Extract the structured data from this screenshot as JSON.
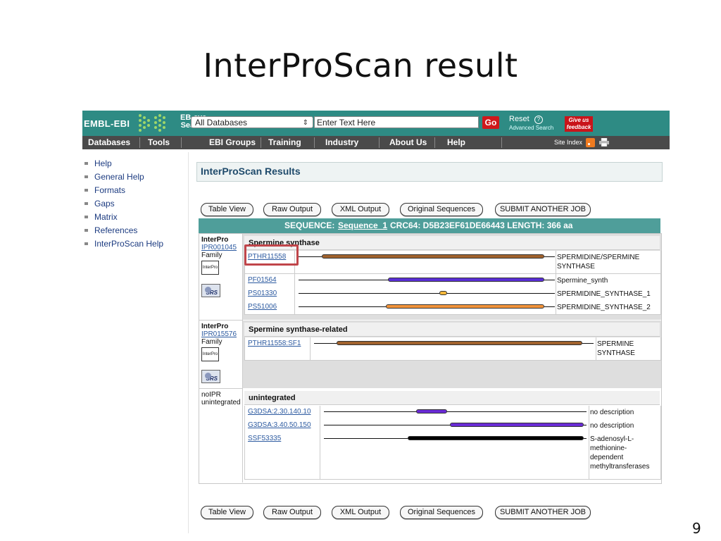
{
  "slide": {
    "title": "InterProScan result",
    "page_number": "9"
  },
  "header": {
    "logo": "EMBL-EBI",
    "eb_eye_line1": "EB-eye",
    "eb_eye_line2": "Search",
    "database_select": "All Databases",
    "search_placeholder": "Enter Text Here",
    "go_label": "Go",
    "reset_label": "Reset",
    "help_glyph": "?",
    "advanced_search": "Advanced Search",
    "feedback_line1": "Give us",
    "feedback_line2": "feedback",
    "brand_color": "#2e8b84",
    "go_color": "#d0181b"
  },
  "nav": {
    "items": [
      "Databases",
      "Tools",
      "EBI Groups",
      "Training",
      "Industry",
      "About Us",
      "Help"
    ],
    "site_index": "Site Index",
    "rss_icon": "rss-icon",
    "print_icon": "print-icon"
  },
  "sidebar": {
    "links": [
      "Help",
      "General Help",
      "Formats",
      "Gaps",
      "Matrix",
      "References",
      "InterProScan Help"
    ]
  },
  "results": {
    "title": "InterProScan Results",
    "buttons": [
      "Table View",
      "Raw Output",
      "XML Output",
      "Original Sequences",
      "SUBMIT ANOTHER JOB"
    ],
    "sequence_bar": {
      "prefix": "SEQUENCE:",
      "sequence_link": "Sequence_1",
      "suffix": "CRC64: D5B23EF61DE66443 LENGTH: 366 aa"
    },
    "sequence_length": 366,
    "entries": [
      {
        "type_label": "InterPro",
        "accession": "IPR001045",
        "kind": "Family",
        "badge": "InterPro",
        "srs": "SRS",
        "title": "Spermine synthase",
        "matches": [
          {
            "acc": "PTHR11558",
            "label_line1": "SPERMIDINE/SPERMINE",
            "label_line2": "SYNTHASE",
            "start": 0.09,
            "end": 0.96,
            "color": "#a0622d"
          },
          {
            "acc": "PF01564",
            "label_line1": "Spermine_synth",
            "label_line2": "",
            "start": 0.35,
            "end": 0.96,
            "color": "#5a2fd6"
          },
          {
            "acc": "PS01330",
            "label_line1": "SPERMIDINE_SYNTHASE_1",
            "label_line2": "",
            "start": 0.55,
            "end": 0.58,
            "color": "#f5b83a"
          },
          {
            "acc": "PS51006",
            "label_line1": "SPERMIDINE_SYNTHASE_2",
            "label_line2": "",
            "start": 0.34,
            "end": 0.96,
            "color": "#f2933a"
          }
        ]
      },
      {
        "type_label": "InterPro",
        "accession": "IPR015576",
        "kind": "Family",
        "badge": "InterPro",
        "srs": "SRS",
        "title": "Spermine synthase-related",
        "matches": [
          {
            "acc": "PTHR11558:SF1",
            "label_line1": "SPERMINE",
            "label_line2": "SYNTHASE",
            "start": 0.08,
            "end": 0.96,
            "color": "#a0622d"
          }
        ]
      },
      {
        "type_label": "noIPR",
        "type_label2": "unintegrated",
        "title": "unintegrated",
        "matches": [
          {
            "acc": "G3DSA:2.30.140.10",
            "label_line1": "no description",
            "start": 0.35,
            "end": 0.47,
            "color": "#6a2bd6"
          },
          {
            "acc": "G3DSA:3.40.50.150",
            "label_line1": "no description",
            "start": 0.48,
            "end": 0.99,
            "color": "#6a2bd6"
          },
          {
            "acc": "SSF53335",
            "label_line1": "S-adenosyl-L-",
            "label_line2": "methionine-",
            "label_line3": "dependent",
            "label_line4": "methyltransferases",
            "start": 0.32,
            "end": 0.99,
            "color": "#000000"
          }
        ]
      }
    ]
  }
}
